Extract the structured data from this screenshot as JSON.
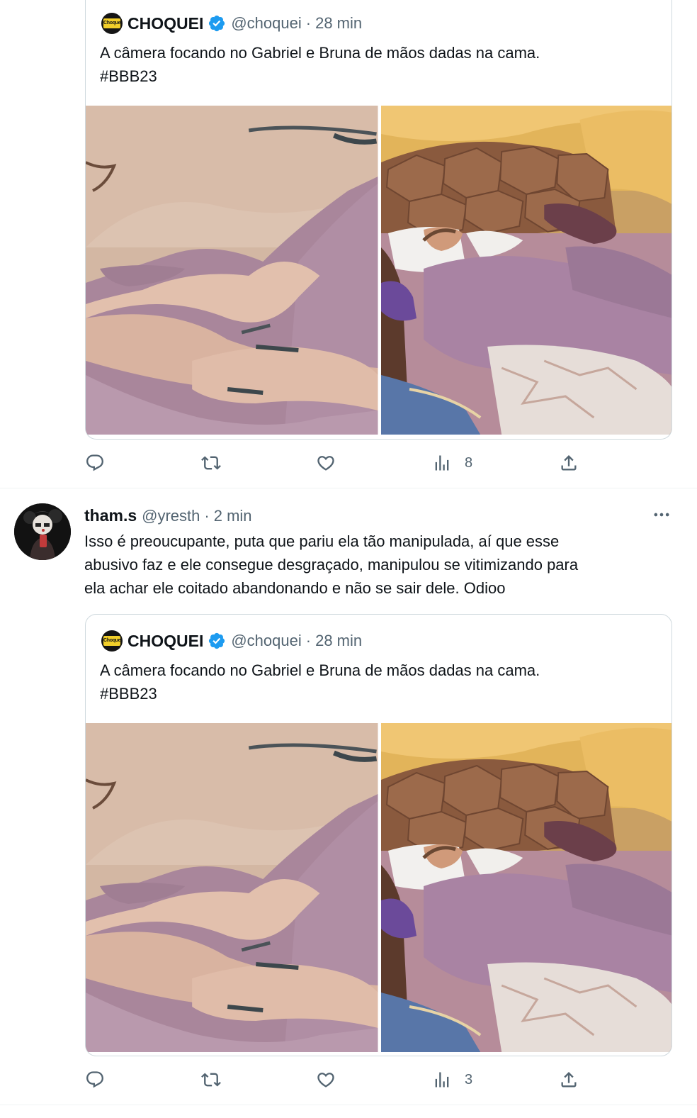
{
  "quoted_tweet": {
    "name": "CHOQUEI",
    "handle": "@choquei",
    "separator": "·",
    "time": "28 min",
    "text_line1": "A câmera focando no Gabriel e Bruna de mãos dadas na cama.",
    "text_line2": "#BBB23",
    "logo_icon": "choquei-logo",
    "verified_color": "#1d9bf0"
  },
  "tweet1_actions": {
    "reply_icon": "reply-icon",
    "retweet_icon": "retweet-icon",
    "like_icon": "heart-icon",
    "views_icon": "views-icon",
    "views_count": "8",
    "share_icon": "share-icon"
  },
  "reply_tweet": {
    "name": "tham.s",
    "handle": "@yresth",
    "separator": "·",
    "time": "2 min",
    "text_line1": "Isso é preoucupante, puta que pariu ela tão manipulada, aí que esse",
    "text_line2": "abusivo faz e ele consegue desgraçado, manipulou se vitimizando para",
    "text_line3": "ela achar ele coitado abandonando e não se sair dele. Odioo",
    "more_icon": "more-icon"
  },
  "tweet2_actions": {
    "views_count": "3"
  },
  "colors": {
    "text": "#0f1419",
    "secondary": "#536471",
    "border": "#cfd9de",
    "accent": "#1d9bf0"
  }
}
